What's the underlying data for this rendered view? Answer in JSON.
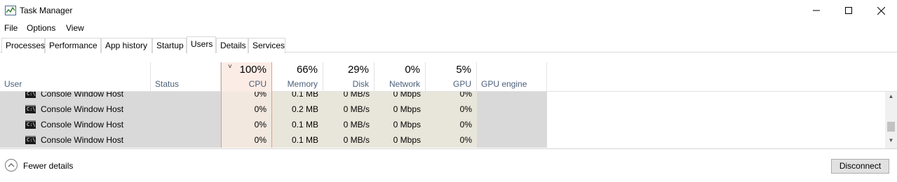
{
  "window": {
    "title": "Task Manager"
  },
  "menu": [
    "File",
    "Options",
    "View"
  ],
  "tabs": [
    "Processes",
    "Performance",
    "App history",
    "Startup",
    "Users",
    "Details",
    "Services"
  ],
  "active_tab": "Users",
  "columns": {
    "user": {
      "label": "User"
    },
    "status": {
      "label": "Status"
    },
    "cpu": {
      "percent": "100%",
      "label": "CPU"
    },
    "memory": {
      "percent": "66%",
      "label": "Memory"
    },
    "disk": {
      "percent": "29%",
      "label": "Disk"
    },
    "network": {
      "percent": "0%",
      "label": "Network"
    },
    "gpu": {
      "percent": "5%",
      "label": "GPU"
    },
    "gpu_engine": {
      "label": "GPU engine"
    }
  },
  "rows": [
    {
      "name": "Console Window Host",
      "cpu": "0%",
      "memory": "0.1 MB",
      "disk": "0 MB/s",
      "network": "0 Mbps",
      "gpu": "0%"
    },
    {
      "name": "Console Window Host",
      "cpu": "0%",
      "memory": "0.2 MB",
      "disk": "0 MB/s",
      "network": "0 Mbps",
      "gpu": "0%"
    },
    {
      "name": "Console Window Host",
      "cpu": "0%",
      "memory": "0.1 MB",
      "disk": "0 MB/s",
      "network": "0 Mbps",
      "gpu": "0%"
    },
    {
      "name": "Console Window Host",
      "cpu": "0%",
      "memory": "0.1 MB",
      "disk": "0 MB/s",
      "network": "0 Mbps",
      "gpu": "0%"
    }
  ],
  "footer": {
    "fewer_details": "Fewer details",
    "disconnect": "Disconnect"
  },
  "icons": {
    "app": "task-manager-icon",
    "row": "console-icon",
    "fewer": "chevron-up-circle-icon"
  },
  "colors": {
    "cpu_highlight": "#fcece6",
    "cpu_border": "#e89b7d",
    "heat": "#e8e6da",
    "row_gray": "#d9d9d9"
  }
}
